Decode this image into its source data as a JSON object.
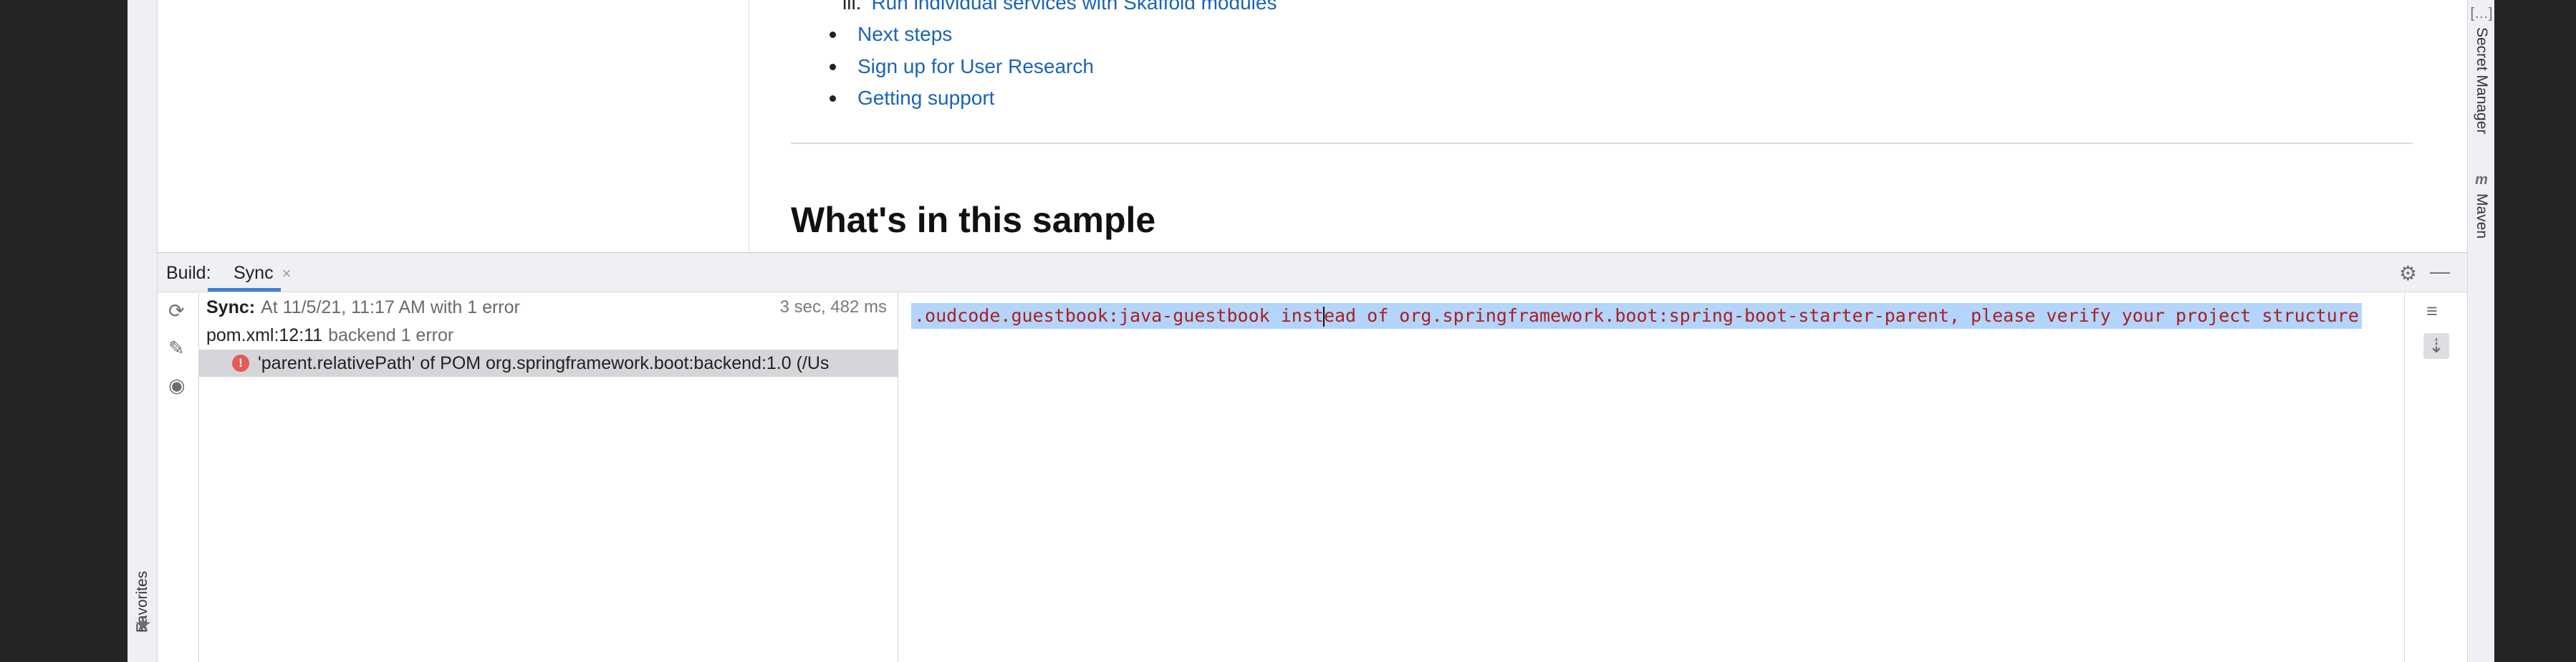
{
  "doc": {
    "nav": {
      "sub_item_number": "iii.",
      "sub_item_label": "Run individual services with Skaffold modules",
      "items": [
        "Next steps",
        "Sign up for User Research",
        "Getting support"
      ]
    },
    "heading": "What's in this sample"
  },
  "right_toolbar": {
    "secret_manager": "Secret Manager",
    "maven": "Maven"
  },
  "left_toolbar": {
    "favorites": "Favorites"
  },
  "build": {
    "title": "Build:",
    "tab_label": "Sync",
    "tab_close": "×",
    "tree": {
      "sync_label": "Sync:",
      "sync_status": "At 11/5/21, 11:17 AM with 1 error",
      "sync_time": "3 sec, 482 ms",
      "pom_location": "pom.xml:12:11",
      "pom_detail": "backend 1 error",
      "error_message": "'parent.relativePath' of POM org.springframework.boot:backend:1.0 (/Us"
    },
    "console": {
      "before_caret": ".oudcode.guestbook:java-guestbook inst",
      "after_caret": "ead of org.springframework.boot:spring-boot-starter-parent, please verify your project structure"
    }
  },
  "icons": {
    "refresh": "refresh-icon",
    "pin": "pin-icon",
    "eye": "eye-icon",
    "gear": "gear-icon",
    "minimize": "minimize-icon",
    "soft_wrap": "soft-wrap-icon",
    "scroll_end": "scroll-to-end-icon",
    "star": "star-icon"
  },
  "colors": {
    "link": "#1a63b8",
    "error_text": "#aa1f1f",
    "selection": "#b3d4fb",
    "error_badge": "#e55a5a",
    "tab_accent": "#3d7fd6"
  }
}
